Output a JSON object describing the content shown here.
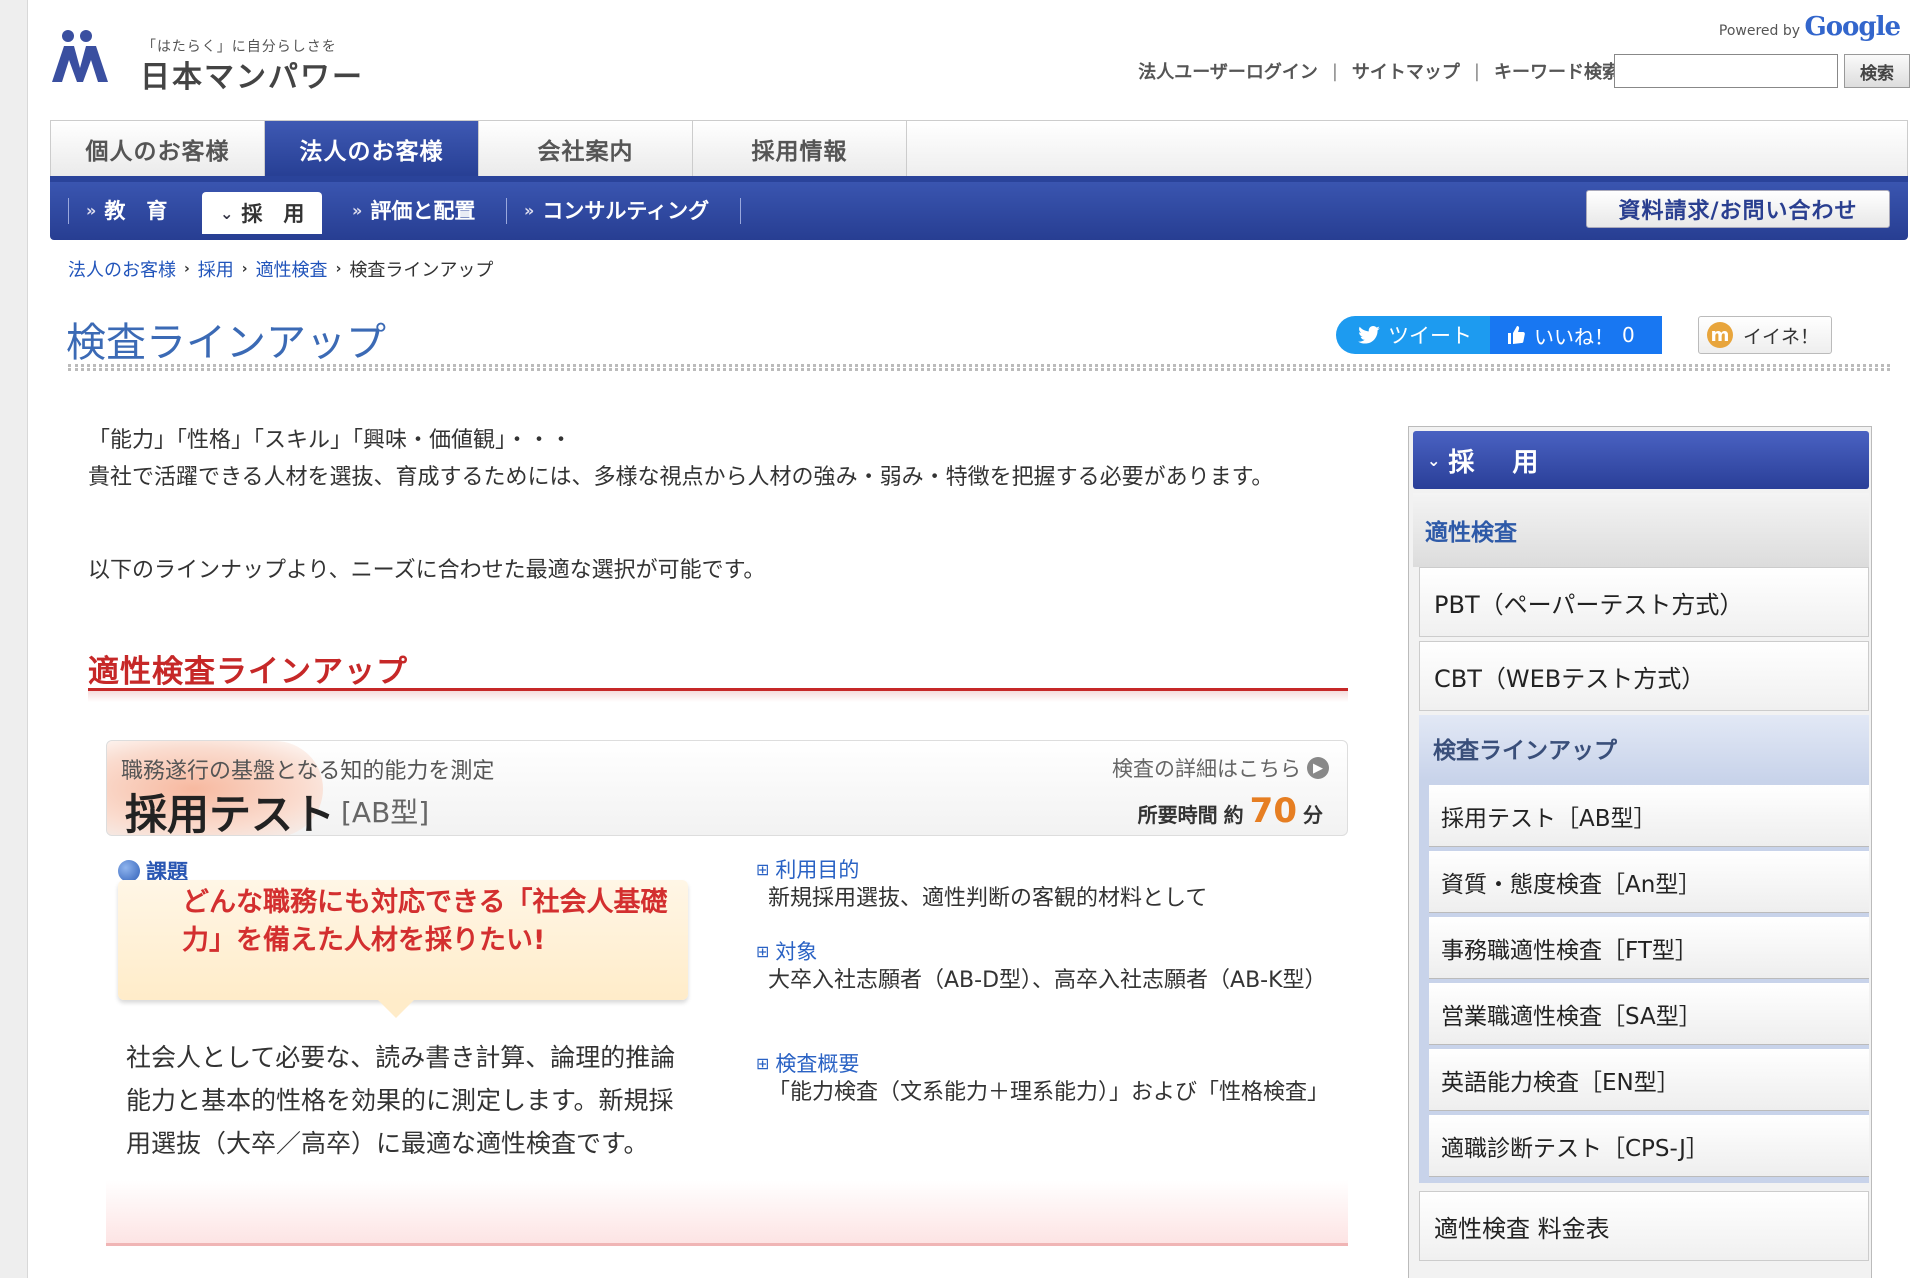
{
  "header": {
    "logo_tagline": "「はたらく」に自分らしさを",
    "logo_name": "日本マンパワー",
    "powered_by": "Powered by",
    "powered_brand": "Google",
    "links": [
      "法人ユーザーログイン",
      "サイトマップ",
      "キーワード検索"
    ],
    "link_separator": "|",
    "search_value": "",
    "search_button": "検索"
  },
  "main_nav": {
    "tabs": [
      {
        "label": "個人のお客様",
        "active": false
      },
      {
        "label": "法人のお客様",
        "active": true
      },
      {
        "label": "会社案内",
        "active": false
      },
      {
        "label": "採用情報",
        "active": false
      }
    ]
  },
  "sub_nav": {
    "items": [
      {
        "label": "教　育",
        "arrow": "»",
        "active": false
      },
      {
        "label": "採　用",
        "arrow": "»",
        "active": true
      },
      {
        "label": "評価と配置",
        "arrow": "»",
        "active": false
      },
      {
        "label": "コンサルティング",
        "arrow": "»",
        "active": false
      }
    ],
    "contact_button": "資料請求/お問い合わせ"
  },
  "breadcrumb": {
    "items": [
      "法人のお客様",
      "採用",
      "適性検査"
    ],
    "current": "検査ラインアップ"
  },
  "page": {
    "title": "検査ラインアップ",
    "social": {
      "tweet": "ツイート",
      "like": "いいね！",
      "like_count": "0",
      "iine": "イイネ！",
      "iine_mark": "m"
    },
    "intro_lines": [
      "「能力」「性格」「スキル」「興味・価値観」・・・",
      "貴社で活躍できる人材を選抜、育成するためには、多様な視点から人材の強み・弱み・特徴を把握する必要があります。"
    ],
    "intro_2": "以下のラインナップより、ニーズに合わせた最適な選択が可能です。",
    "section_heading": "適性検査ラインアップ"
  },
  "test_card": {
    "lead": "職務遂行の基盤となる知的能力を測定",
    "name": "採用テスト",
    "type": "[AB型]",
    "detail_link": "検査の詳細はこちら",
    "time_label": "所要時間",
    "time_prefix": "約",
    "time_value": "70",
    "time_unit": "分",
    "issue_label": "課題",
    "issue_text": "どんな職務にも対応できる「社会人基礎力」を備えた人材を採りたい!",
    "description": "社会人として必要な、読み書き計算、論理的推論能力と基本的性格を効果的に測定します。新規採用選抜（大卒／高卒）に最適な適性検査です。",
    "purpose_label": "利用目的",
    "purpose_value": "新規採用選抜、適性判断の客観的材料として",
    "target_label": "対象",
    "target_value": "大卒入社志願者（AB-D型）、高卒入社志願者（AB-K型）",
    "overview_label": "検査概要",
    "overview_value": "「能力検査（文系能力＋理系能力）」および「性格検査」"
  },
  "sidebar": {
    "header": "採　用",
    "category": "適性検査",
    "items": [
      "PBT（ペーパーテスト方式）",
      "CBT（WEBテスト方式）"
    ],
    "lineup_label": "検査ラインアップ",
    "lineup_items": [
      "採用テスト［AB型］",
      "資質・態度検査［An型］",
      "事務職適性検査［FT型］",
      "営業職適性検査［SA型］",
      "英語能力検査［EN型］",
      "適職診断テスト［CPS-J］"
    ],
    "fee_link": "適性検査 料金表"
  },
  "colors": {
    "nav_blue": "#2a3f98",
    "title_blue": "#3b6ab5",
    "section_red": "#c62828",
    "time_orange": "#e67e22",
    "link_blue": "#2255bb"
  }
}
